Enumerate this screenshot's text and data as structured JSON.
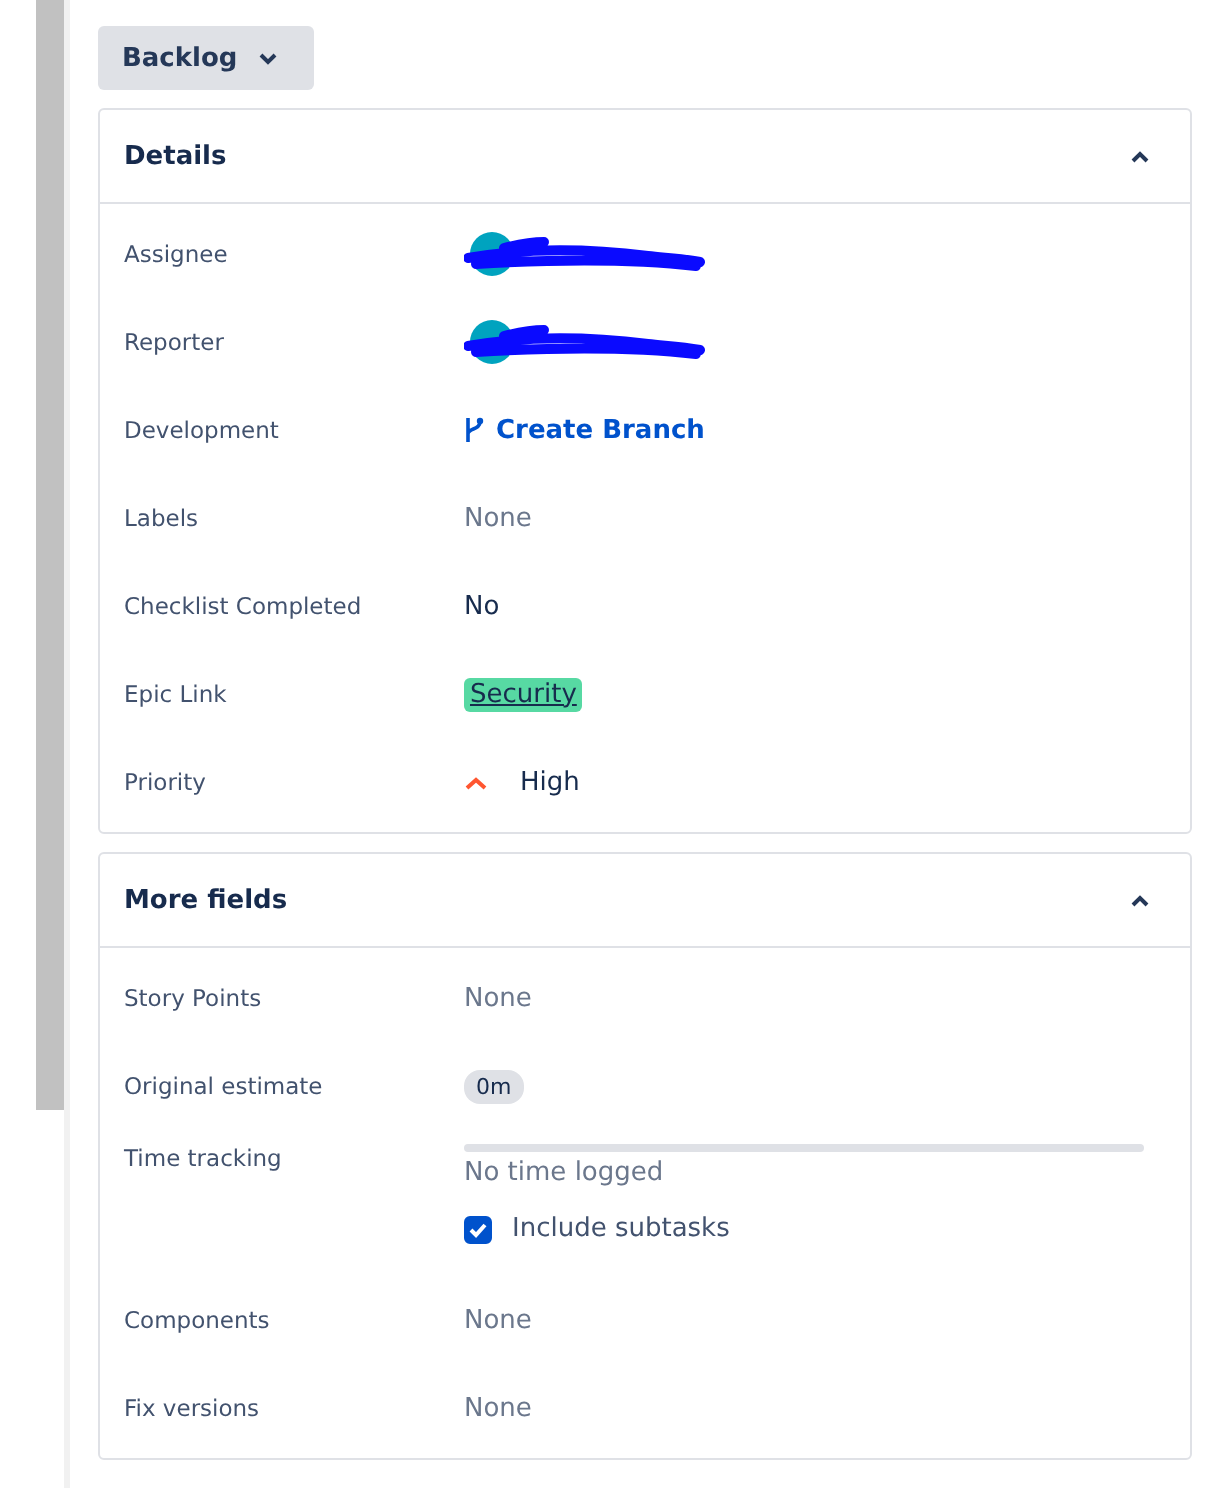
{
  "status_button": {
    "label": "Backlog"
  },
  "sections": [
    {
      "title": "Details",
      "expanded": true,
      "fields": [
        {
          "label": "Assignee",
          "kind": "person"
        },
        {
          "label": "Reporter",
          "kind": "person"
        },
        {
          "label": "Development",
          "kind": "link",
          "value": "Create Branch"
        },
        {
          "label": "Labels",
          "kind": "empty",
          "value": "None"
        },
        {
          "label": "Checklist Completed",
          "kind": "text",
          "value": "No"
        },
        {
          "label": "Epic Link",
          "kind": "epic",
          "value": "Security"
        },
        {
          "label": "Priority",
          "kind": "priority",
          "value": "High"
        }
      ]
    },
    {
      "title": "More fields",
      "expanded": true,
      "fields": [
        {
          "label": "Story Points",
          "kind": "empty",
          "value": "None"
        },
        {
          "label": "Original estimate",
          "kind": "chip",
          "value": "0m"
        },
        {
          "label": "Time tracking",
          "kind": "time_tracking",
          "level": 0,
          "value": "No time logged",
          "checkbox": {
            "label": "Include subtasks",
            "checked": true
          }
        },
        {
          "label": "Components",
          "kind": "empty",
          "value": "None"
        },
        {
          "label": "Fix versions",
          "kind": "empty",
          "value": "None"
        }
      ]
    }
  ]
}
